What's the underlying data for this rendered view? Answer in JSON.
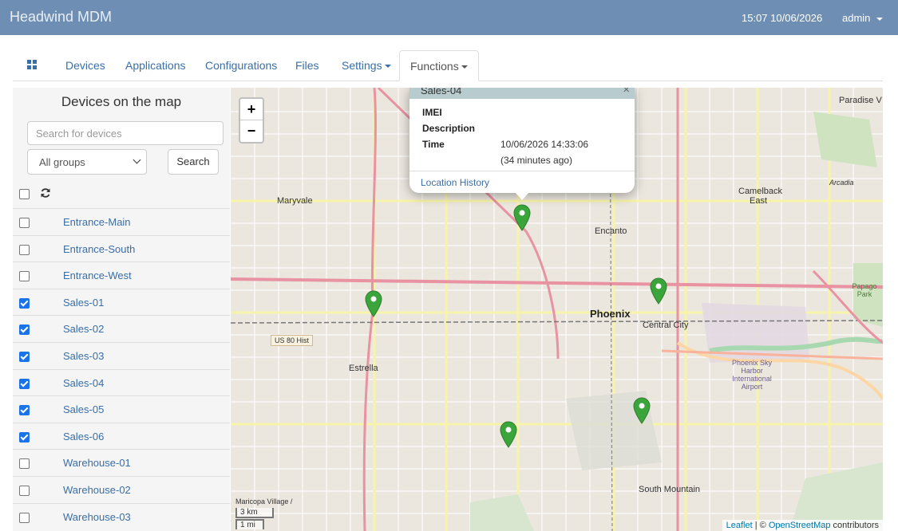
{
  "app": {
    "title": "Headwind MDM",
    "datetime": "15:07 10/06/2026",
    "user": "admin"
  },
  "nav": {
    "tabs": [
      {
        "label": "Devices"
      },
      {
        "label": "Applications"
      },
      {
        "label": "Configurations"
      },
      {
        "label": "Files"
      },
      {
        "label": "Settings"
      },
      {
        "label": "Functions"
      }
    ],
    "active": "Functions"
  },
  "sidebar": {
    "title": "Devices on the map",
    "search_placeholder": "Search for devices",
    "group_selected": "All groups",
    "search_button": "Search",
    "devices": [
      {
        "name": "Entrance-Main",
        "checked": false
      },
      {
        "name": "Entrance-South",
        "checked": false
      },
      {
        "name": "Entrance-West",
        "checked": false
      },
      {
        "name": "Sales-01",
        "checked": true
      },
      {
        "name": "Sales-02",
        "checked": true
      },
      {
        "name": "Sales-03",
        "checked": true
      },
      {
        "name": "Sales-04",
        "checked": true
      },
      {
        "name": "Sales-05",
        "checked": true
      },
      {
        "name": "Sales-06",
        "checked": true
      },
      {
        "name": "Warehouse-01",
        "checked": false
      },
      {
        "name": "Warehouse-02",
        "checked": false
      },
      {
        "name": "Warehouse-03",
        "checked": false
      }
    ]
  },
  "popup": {
    "title": "Sales-04",
    "imei_label": "IMEI",
    "description_label": "Description",
    "time_label": "Time",
    "time_value": "10/06/2026 14:33:06",
    "time_ago": "(34 minutes ago)",
    "link": "Location History"
  },
  "map": {
    "zoom_in": "+",
    "zoom_out": "−",
    "scale_km": "3 km",
    "scale_mi": "1 mi",
    "attribution_leaflet": "Leaflet",
    "attribution_sep": " | © ",
    "attribution_osm": "OpenStreetMap",
    "attribution_tail": " contributors",
    "places": {
      "phoenix": "Phoenix",
      "maryvale": "Maryvale",
      "encanto": "Encanto",
      "central_city": "Central City",
      "estrella": "Estrella",
      "south_mountain": "South Mountain",
      "camelback_east": "Camelback East",
      "paradise": "Paradise V",
      "arcadia": "Arcadia",
      "papago": "Papago Park",
      "sky_harbor": "Phoenix Sky Harbor International Airport",
      "us80": "US 80 Hist",
      "maricopa": "Maricopa Village /"
    },
    "marker_color": "#3aa53a"
  }
}
